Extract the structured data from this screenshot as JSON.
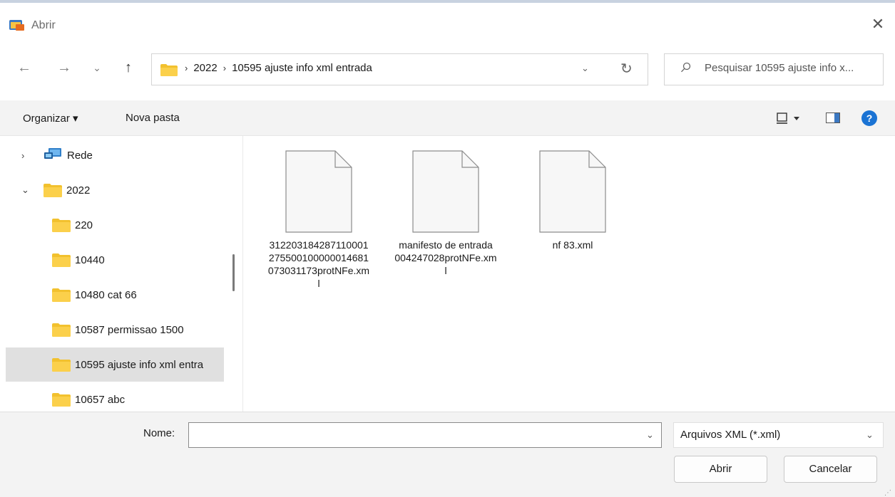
{
  "window": {
    "title": "Abrir",
    "close_glyph": "✕"
  },
  "nav": {
    "back_glyph": "←",
    "forward_glyph": "→",
    "recent_glyph": "⌄",
    "up_glyph": "↑",
    "breadcrumbs": [
      "2022",
      "10595 ajuste info xml entrada"
    ],
    "separator": "›",
    "dropdown_glyph": "⌄",
    "refresh_glyph": "↻"
  },
  "search": {
    "placeholder": "Pesquisar 10595 ajuste info x..."
  },
  "toolbar": {
    "organize_label": "Organizar ▾",
    "new_folder_label": "Nova pasta",
    "help_label": "?"
  },
  "sidebar": {
    "items": [
      {
        "label": "Rede",
        "icon": "network-icon",
        "chevron": "›"
      },
      {
        "label": "2022",
        "icon": "folder-icon",
        "chevron": "⌄"
      },
      {
        "label": "220",
        "icon": "folder-icon"
      },
      {
        "label": "10440",
        "icon": "folder-icon"
      },
      {
        "label": "10480 cat 66",
        "icon": "folder-icon"
      },
      {
        "label": "10587 permissao 1500",
        "icon": "folder-icon"
      },
      {
        "label": "10595 ajuste info xml entra",
        "icon": "folder-icon",
        "selected": true
      },
      {
        "label": "10657 abc",
        "icon": "folder-icon"
      }
    ]
  },
  "files": [
    {
      "name": "312203184287110001275500100000014681073031173protNFe.xml",
      "icon": "document-icon"
    },
    {
      "name": "manifesto de entrada 004247028protNFe.xml",
      "icon": "document-icon"
    },
    {
      "name": "nf 83.xml",
      "icon": "document-icon"
    }
  ],
  "bottom": {
    "name_label": "Nome:",
    "name_value": "",
    "filetype_value": "Arquivos XML (*.xml)",
    "dropdown_glyph": "⌄",
    "open_label": "Abrir",
    "cancel_label": "Cancelar",
    "resize_glyph": "⋰"
  },
  "colors": {
    "folder": "#f2c12e",
    "accent": "#1a73d4",
    "selected_bg": "#e0e0e0",
    "toolbar_bg": "#f3f3f3"
  }
}
